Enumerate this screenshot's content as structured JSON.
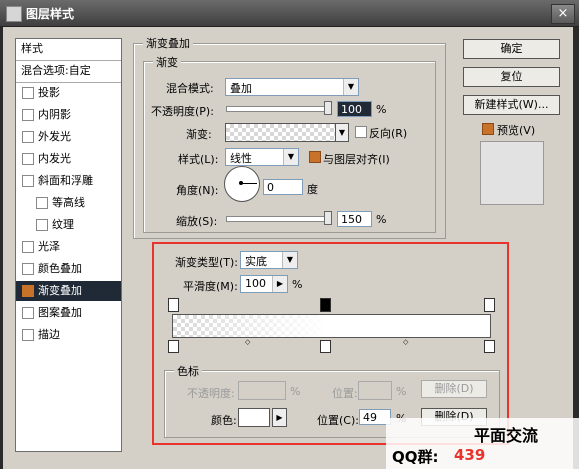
{
  "window": {
    "title": "图层样式",
    "close": "×"
  },
  "sidebar": {
    "header": "样式",
    "blend": "混合选项:自定",
    "items": [
      {
        "label": "投影",
        "sub": false,
        "checked": false
      },
      {
        "label": "内阴影",
        "sub": false,
        "checked": false
      },
      {
        "label": "外发光",
        "sub": false,
        "checked": false
      },
      {
        "label": "内发光",
        "sub": false,
        "checked": false
      },
      {
        "label": "斜面和浮雕",
        "sub": false,
        "checked": false
      },
      {
        "label": "等高线",
        "sub": true,
        "checked": false
      },
      {
        "label": "纹理",
        "sub": true,
        "checked": false
      },
      {
        "label": "光泽",
        "sub": false,
        "checked": false
      },
      {
        "label": "颜色叠加",
        "sub": false,
        "checked": false
      },
      {
        "label": "渐变叠加",
        "sub": false,
        "checked": true,
        "selected": true
      },
      {
        "label": "图案叠加",
        "sub": false,
        "checked": false
      },
      {
        "label": "描边",
        "sub": false,
        "checked": false
      }
    ]
  },
  "overlay": {
    "group": "渐变叠加",
    "subgroup": "渐变",
    "blend_label": "混合模式:",
    "blend_value": "叠加",
    "opacity_label": "不透明度(P):",
    "opacity_value": "100",
    "opacity_unit": "%",
    "opacity_level": 100,
    "gradient_label": "渐变:",
    "reverse_label": "反向(R)",
    "style_label": "样式(L):",
    "style_value": "线性",
    "align_label": "与图层对齐(I)",
    "angle_label": "角度(N):",
    "angle_value": "0",
    "angle_unit": "度",
    "scale_label": "缩放(S):",
    "scale_value": "150",
    "scale_unit": "%",
    "scale_level": 100
  },
  "buttons": {
    "ok": "确定",
    "reset": "复位",
    "new_style": "新建样式(W)...",
    "preview": "预览(V)"
  },
  "editor": {
    "type_label": "渐变类型(T):",
    "type_value": "实底",
    "smooth_label": "平滑度(M):",
    "smooth_value": "100",
    "smooth_unit": "%",
    "stops_group": "色标",
    "opacity_label": "不透明度:",
    "opacity_unit": "%",
    "location_label": "位置:",
    "location_unit": "%",
    "delete_label": "删除(D)",
    "color_label": "颜色:",
    "color_location_label": "位置(C):",
    "color_location_value": "49",
    "color_location_unit": "%",
    "color_delete_label": "删除(D)",
    "highlight": "#e8342c"
  },
  "watermark": {
    "line1": "平面交流",
    "qq_label": "QQ群:",
    "qq_num": "439"
  }
}
